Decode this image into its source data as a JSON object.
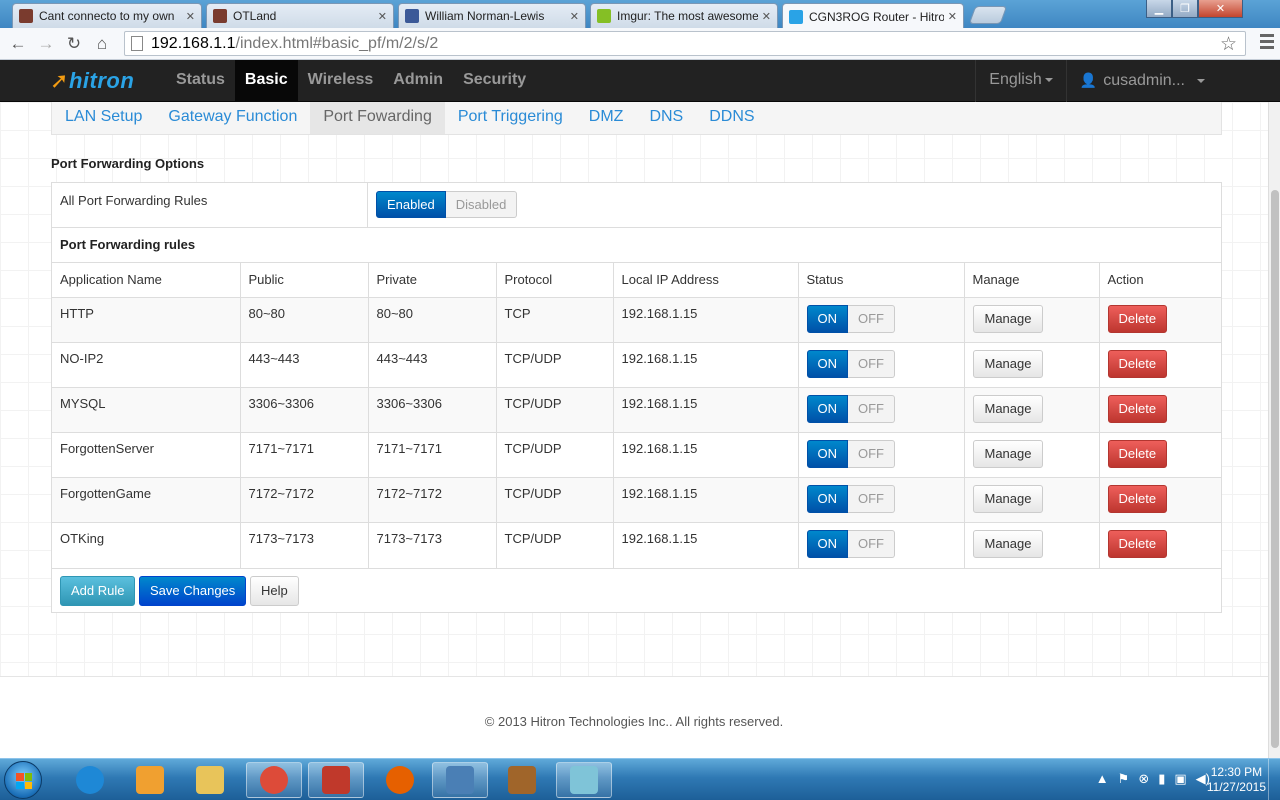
{
  "browser": {
    "tabs": [
      {
        "label": "Cant connecto to my own",
        "favicon_color": "#7a3b2e"
      },
      {
        "label": "OTLand",
        "favicon_color": "#7a3b2e"
      },
      {
        "label": "William Norman-Lewis",
        "favicon_color": "#3b5998"
      },
      {
        "label": "Imgur: The most awesome",
        "favicon_color": "#85bf25"
      },
      {
        "label": "CGN3ROG Router - Hitron",
        "favicon_color": "#2aa3e6"
      }
    ],
    "active_tab_index": 4,
    "url_host": "192.168.1.1",
    "url_path": "/index.html#basic_pf/m/2/s/2"
  },
  "router": {
    "logo": "hitron",
    "main_nav": [
      "Status",
      "Basic",
      "Wireless",
      "Admin",
      "Security"
    ],
    "main_nav_active": "Basic",
    "language": "English",
    "user": "cusadmin...",
    "sub_nav": [
      "LAN Setup",
      "Gateway Function",
      "Port Fowarding",
      "Port Triggering",
      "DMZ",
      "DNS",
      "DDNS"
    ],
    "sub_nav_active": "Port Fowarding",
    "section_title": "Port Forwarding Options",
    "all_rules_label": "All Port Forwarding Rules",
    "enabled_label": "Enabled",
    "disabled_label": "Disabled",
    "all_rules_state": "Enabled",
    "rules_title": "Port Forwarding rules",
    "columns": [
      "Application Name",
      "Public",
      "Private",
      "Protocol",
      "Local IP Address",
      "Status",
      "Manage",
      "Action"
    ],
    "rows": [
      {
        "name": "HTTP",
        "public": "80~80",
        "private": "80~80",
        "protocol": "TCP",
        "ip": "192.168.1.15",
        "status": "ON"
      },
      {
        "name": "NO-IP2",
        "public": "443~443",
        "private": "443~443",
        "protocol": "TCP/UDP",
        "ip": "192.168.1.15",
        "status": "ON"
      },
      {
        "name": "MYSQL",
        "public": "3306~3306",
        "private": "3306~3306",
        "protocol": "TCP/UDP",
        "ip": "192.168.1.15",
        "status": "ON"
      },
      {
        "name": "ForgottenServer",
        "public": "7171~7171",
        "private": "7171~7171",
        "protocol": "TCP/UDP",
        "ip": "192.168.1.15",
        "status": "ON"
      },
      {
        "name": "ForgottenGame",
        "public": "7172~7172",
        "private": "7172~7172",
        "protocol": "TCP/UDP",
        "ip": "192.168.1.15",
        "status": "ON"
      },
      {
        "name": "OTKing",
        "public": "7173~7173",
        "private": "7173~7173",
        "protocol": "TCP/UDP",
        "ip": "192.168.1.15",
        "status": "ON"
      }
    ],
    "on_label": "ON",
    "off_label": "OFF",
    "manage_label": "Manage",
    "delete_label": "Delete",
    "add_rule_label": "Add Rule",
    "save_label": "Save Changes",
    "help_label": "Help",
    "footer": "© 2013 Hitron Technologies Inc.. All rights reserved."
  },
  "taskbar": {
    "apps": [
      {
        "name": "internet-explorer-icon",
        "color": "#1e88d6",
        "open": false
      },
      {
        "name": "media-player-icon",
        "color": "#f0a030",
        "open": false
      },
      {
        "name": "file-explorer-icon",
        "color": "#e8c45a",
        "open": false
      },
      {
        "name": "chrome-icon",
        "color": "#dd4b39",
        "open": true
      },
      {
        "name": "game-character-icon",
        "color": "#c0392b",
        "open": true
      },
      {
        "name": "firefox-icon",
        "color": "#e66000",
        "open": false
      },
      {
        "name": "window-app-icon",
        "color": "#4a7fb5",
        "open": true
      },
      {
        "name": "squirrel-icon",
        "color": "#a0652a",
        "open": false
      },
      {
        "name": "notepad-icon",
        "color": "#7fc4d8",
        "open": true
      }
    ],
    "time": "12:30 PM",
    "date": "11/27/2015"
  }
}
